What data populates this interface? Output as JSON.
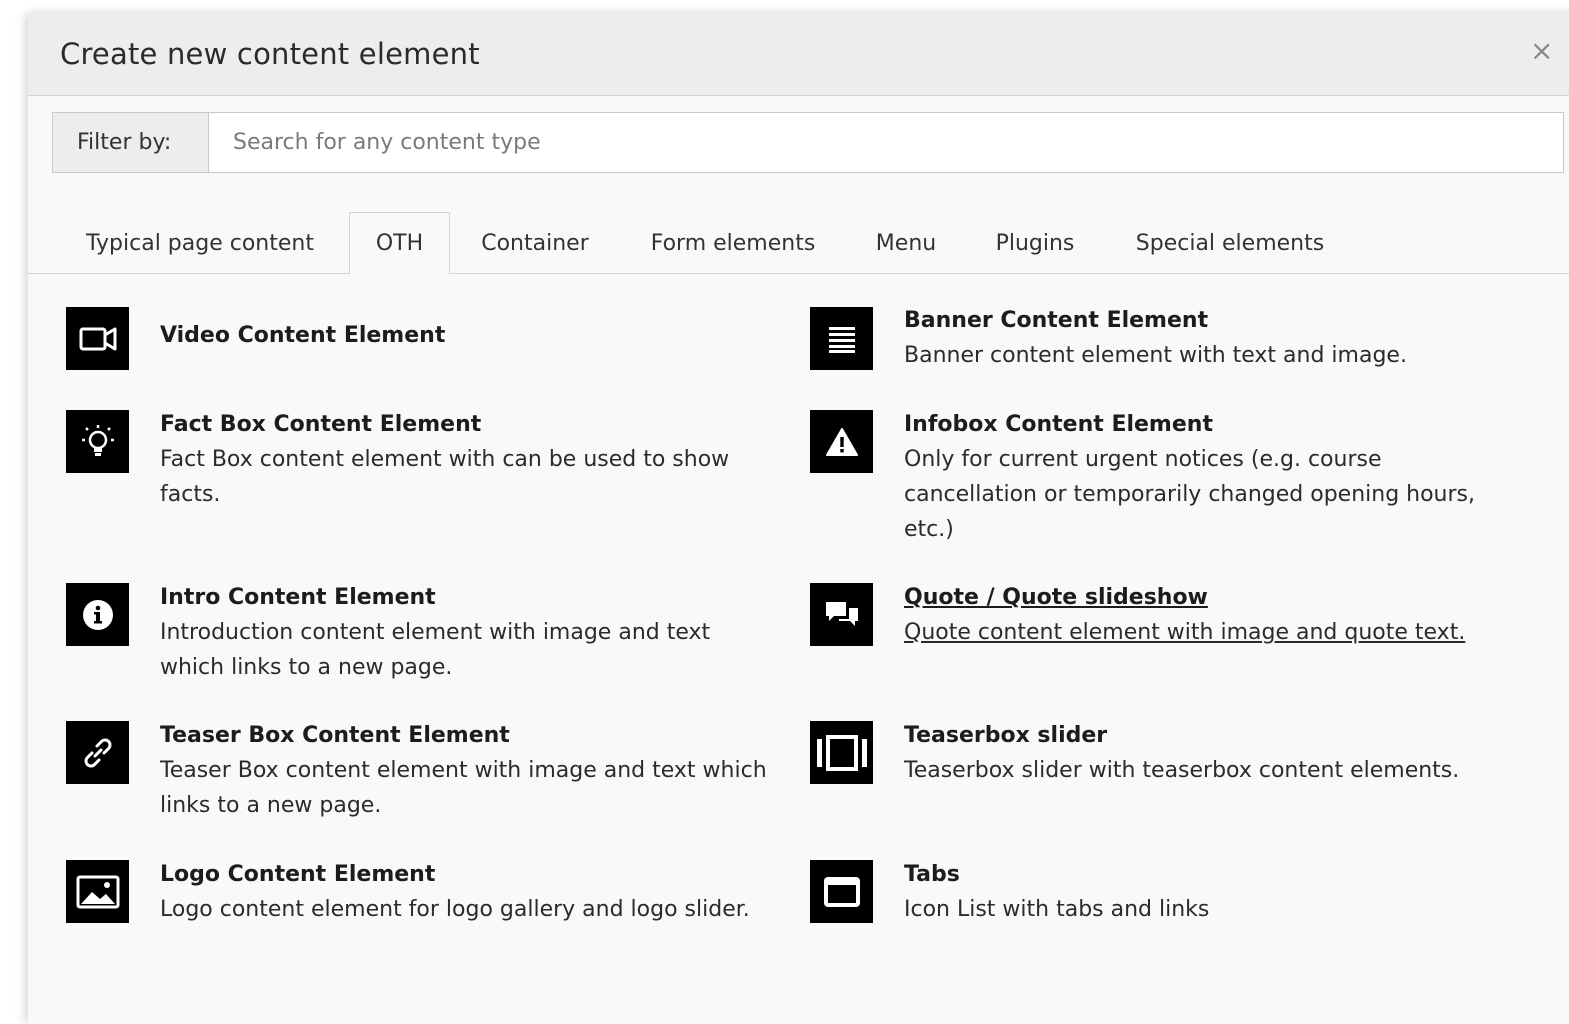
{
  "modal": {
    "title": "Create new content element",
    "close_label": "×"
  },
  "filter": {
    "label": "Filter by:",
    "placeholder": "Search for any content type",
    "value": ""
  },
  "tabs": [
    {
      "label": "Typical page content"
    },
    {
      "label": "OTH",
      "active": true
    },
    {
      "label": "Container"
    },
    {
      "label": "Form elements"
    },
    {
      "label": "Menu"
    },
    {
      "label": "Plugins"
    },
    {
      "label": "Special elements"
    }
  ],
  "elements": [
    {
      "icon": "video-icon",
      "title": "Video Content Element",
      "description": ""
    },
    {
      "icon": "list-icon",
      "title": "Banner Content Element",
      "description": "Banner content element with text and image."
    },
    {
      "icon": "lightbulb-icon",
      "title": "Fact Box Content Element",
      "description": "Fact Box content element with can be used to show facts."
    },
    {
      "icon": "warning-icon",
      "title": "Infobox Content Element",
      "description": "Only for current urgent notices (e.g. course cancellation or temporarily changed opening hours, etc.)"
    },
    {
      "icon": "info-icon",
      "title": "Intro Content Element",
      "description": "Introduction content element with image and text which links to a new page."
    },
    {
      "icon": "comments-icon",
      "title": "Quote / Quote slideshow",
      "description": "Quote content element with image and quote text.",
      "hover": true
    },
    {
      "icon": "link-icon",
      "title": "Teaser Box Content Element",
      "description": "Teaser Box content element with image and text which links to a new page."
    },
    {
      "icon": "slider-icon",
      "title": "Teaserbox slider",
      "description": "Teaserbox slider with teaserbox content elements."
    },
    {
      "icon": "image-icon",
      "title": "Logo Content Element",
      "description": "Logo content element for logo gallery and logo slider."
    },
    {
      "icon": "window-icon",
      "title": "Tabs",
      "description": "Icon List with tabs and links"
    }
  ]
}
